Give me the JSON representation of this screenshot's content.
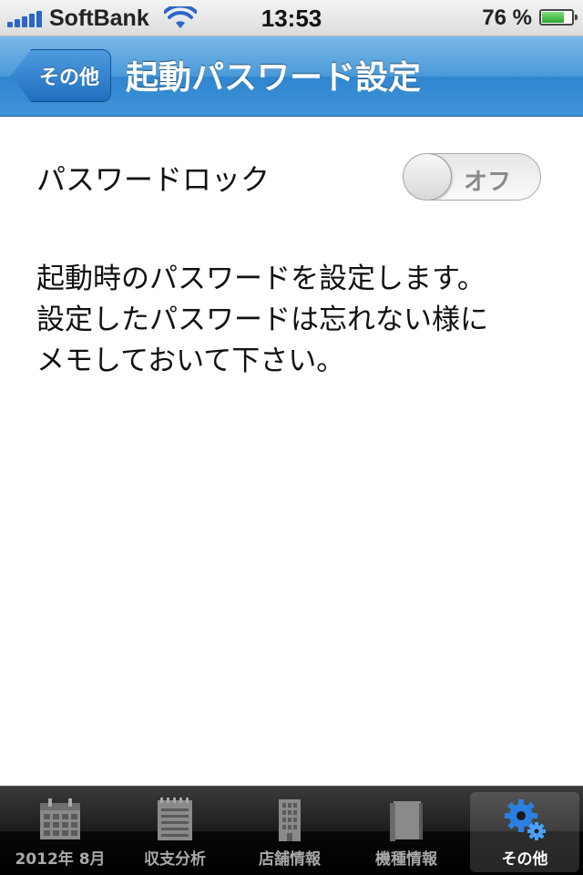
{
  "status_bar": {
    "carrier": "SoftBank",
    "time": "13:53",
    "battery_percent": "76 %",
    "battery_level": 0.76
  },
  "nav": {
    "back_label": "その他",
    "title": "起動パスワード設定"
  },
  "settings": {
    "password_lock_label": "パスワードロック",
    "toggle_state": "オフ"
  },
  "description_lines": [
    "起動時のパスワードを設定します。",
    "設定したパスワードは忘れない様に",
    "メモしておいて下さい。"
  ],
  "tab_bar": {
    "tabs": [
      {
        "label": "2012年 8月",
        "icon": "calendar-icon",
        "selected": false
      },
      {
        "label": "収支分析",
        "icon": "notepad-icon",
        "selected": false
      },
      {
        "label": "店舗情報",
        "icon": "building-icon",
        "selected": false
      },
      {
        "label": "機種情報",
        "icon": "book-icon",
        "selected": false
      },
      {
        "label": "その他",
        "icon": "gears-icon",
        "selected": true
      }
    ]
  },
  "colors": {
    "nav_blue": "#3f93d8",
    "selected_icon_blue": "#2b7fe0",
    "tab_bar_black": "#000000"
  }
}
